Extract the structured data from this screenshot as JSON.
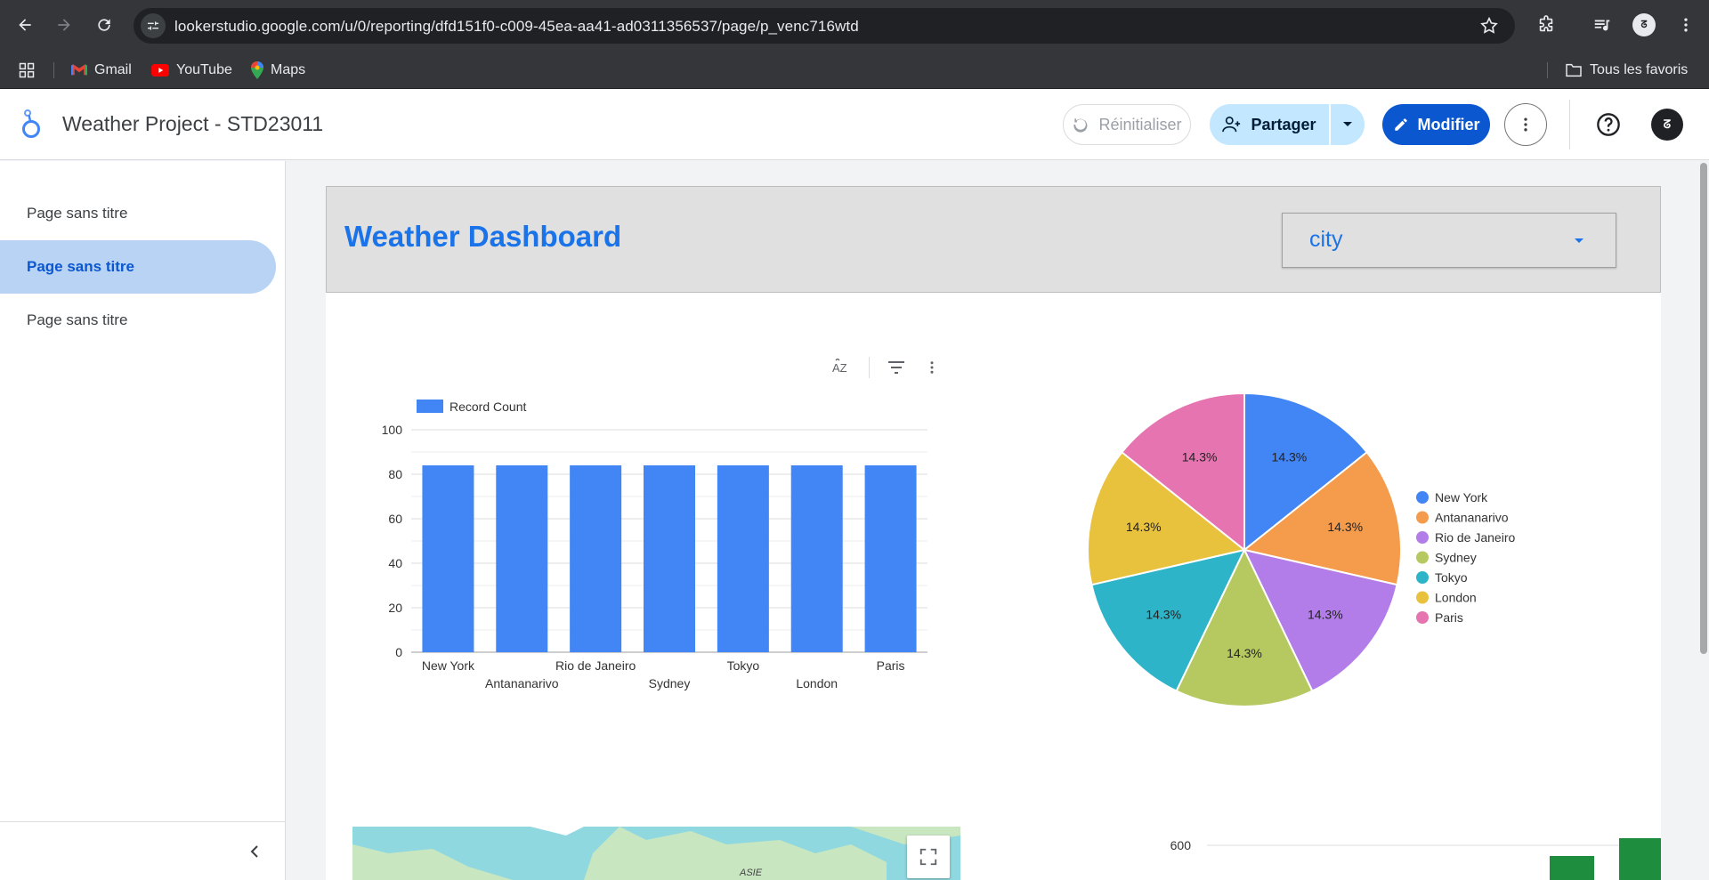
{
  "browser": {
    "url": "lookerstudio.google.com/u/0/reporting/dfd151f0-c009-45ea-aa41-ad0311356537/page/p_venc716wtd",
    "profile_initials": "ᘔ",
    "bookmarks": [
      {
        "label": "Gmail",
        "icon": "gmail-icon"
      },
      {
        "label": "YouTube",
        "icon": "youtube-icon"
      },
      {
        "label": "Maps",
        "icon": "maps-icon"
      }
    ],
    "all_bookmarks_label": "Tous les favoris"
  },
  "header": {
    "report_title": "Weather Project - STD23011",
    "reset_label": "Réinitialiser",
    "share_label": "Partager",
    "edit_label": "Modifier",
    "avatar_initials": "ᘔ"
  },
  "nav": {
    "pages": [
      {
        "label": "Page sans titre",
        "active": false
      },
      {
        "label": "Page sans titre",
        "active": true
      },
      {
        "label": "Page sans titre",
        "active": false
      }
    ]
  },
  "dashboard": {
    "title": "Weather Dashboard",
    "filter_label": "city"
  },
  "colors": {
    "accent": "#1a73e8",
    "bar": "#4285f4",
    "pie": [
      "#4285f4",
      "#f59b4c",
      "#b27de8",
      "#b5c960",
      "#2db4c8",
      "#e8c13d",
      "#e574b0"
    ]
  },
  "map": {
    "label": "ASIE"
  },
  "chart_data": [
    {
      "type": "bar",
      "categories": [
        "New York",
        "Antananarivo",
        "Rio de Janeiro",
        "Sydney",
        "Tokyo",
        "London",
        "Paris"
      ],
      "series": [
        {
          "name": "Record Count",
          "values": [
            84,
            84,
            84,
            84,
            84,
            84,
            84
          ]
        }
      ],
      "ylim": [
        0,
        100
      ],
      "yticks": [
        0,
        20,
        40,
        60,
        80,
        100
      ],
      "grid": true,
      "legend": "top-left"
    },
    {
      "type": "pie",
      "categories": [
        "New York",
        "Antananarivo",
        "Rio de Janeiro",
        "Sydney",
        "Tokyo",
        "London",
        "Paris"
      ],
      "values": [
        14.3,
        14.3,
        14.3,
        14.3,
        14.3,
        14.3,
        14.3
      ],
      "labels": [
        "14.3%",
        "14.3%",
        "14.3%",
        "14.3%",
        "14.3%",
        "14.3%",
        "14.3%"
      ],
      "legend": "right"
    },
    {
      "type": "bar",
      "yticks": [
        600
      ]
    }
  ]
}
